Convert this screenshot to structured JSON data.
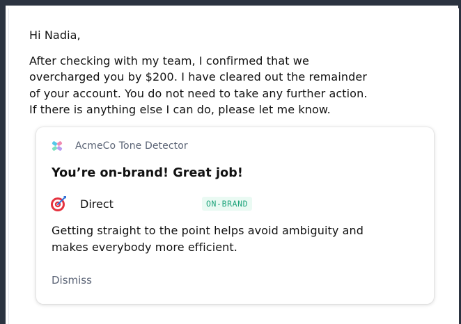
{
  "email": {
    "greeting": "Hi Nadia,",
    "body_lines": [
      "After checking with my team, I confirmed that we",
      "overcharged you by $200. I have cleared out the remainder",
      "of your account. You do not need to take any further action.",
      "If there is anything else I can do, please let me know."
    ]
  },
  "tone_card": {
    "app_name": "AcmeCo Tone Detector",
    "app_icon": "acmeco-logo-icon",
    "title": "You’re on-brand! Great job!",
    "tone": {
      "icon": "target-icon",
      "name": "Direct",
      "badge": "ON-BRAND"
    },
    "description_lines": [
      "Getting straight to the point helps avoid ambiguity and",
      "makes everybody more efficient."
    ],
    "dismiss_label": "Dismiss"
  },
  "colors": {
    "frame": "#2b3340",
    "badge_background": "#eafaf3",
    "badge_text": "#1fa47c",
    "muted_text": "#5b6476",
    "target_red": "#e5323f",
    "target_dart": "#2f6fd6"
  }
}
